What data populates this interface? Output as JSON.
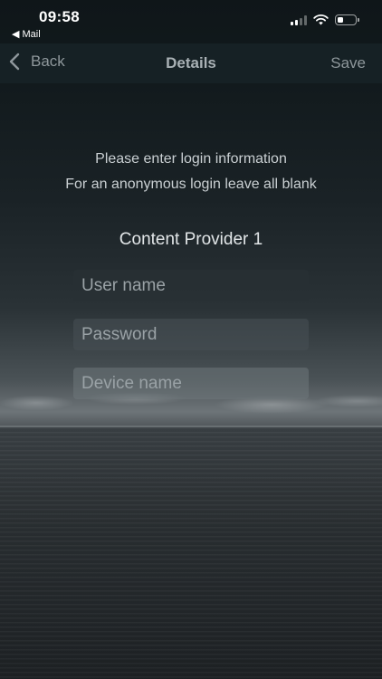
{
  "status_bar": {
    "time": "09:58",
    "back_app": "◀ Mail",
    "battery_level": 0.35
  },
  "nav": {
    "back_label": "Back",
    "title": "Details",
    "save_label": "Save"
  },
  "form": {
    "instruction_line1": "Please enter login information",
    "instruction_line2": "For an anonymous login leave all blank",
    "section_title": "Content Provider 1",
    "username_placeholder": "User name",
    "password_placeholder": "Password",
    "device_placeholder": "Device name"
  },
  "colors": {
    "nav_background": "#162125",
    "nav_text": "#8e979b"
  }
}
